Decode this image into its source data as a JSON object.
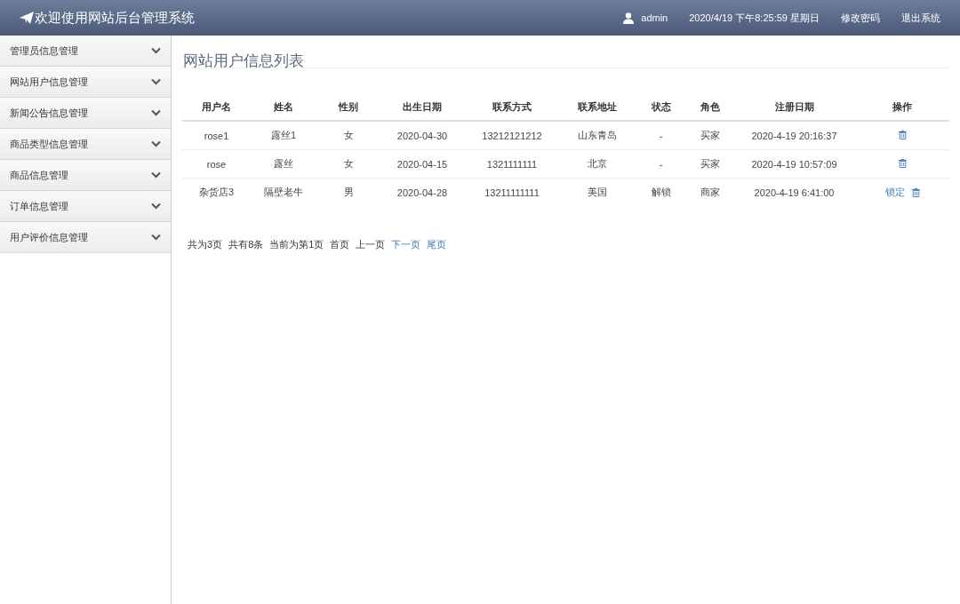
{
  "header": {
    "title": "欢迎使用网站后台管理系统",
    "user": "admin",
    "datetime": "2020/4/19 下午8:25:59 星期日",
    "links": [
      "修改密码",
      "退出系统"
    ]
  },
  "sidebar": {
    "items": [
      {
        "label": "管理员信息管理",
        "expanded": false
      },
      {
        "label": "网站用户信息管理",
        "expanded": false
      },
      {
        "label": "新闻公告信息管理",
        "expanded": false
      },
      {
        "label": "商品类型信息管理",
        "expanded": false
      },
      {
        "label": "商品信息管理",
        "expanded": false
      },
      {
        "label": "订单信息管理",
        "expanded": false
      },
      {
        "label": "用户评价信息管理",
        "expanded": false
      }
    ]
  },
  "page_title": "网站用户信息列表",
  "table": {
    "columns": [
      "用户名",
      "姓名",
      "性别",
      "出生日期",
      "联系方式",
      "联系地址",
      "状态",
      "角色",
      "注册日期",
      "操作"
    ],
    "rows": [
      {
        "cells": [
          "rose1",
          "露丝1",
          "女",
          "2020-04-30",
          "13212121212",
          "山东青岛",
          "-",
          "买家",
          "2020-4-19 20:16:37"
        ],
        "actions": [
          {
            "kind": "delete"
          }
        ]
      },
      {
        "cells": [
          "rose",
          "露丝",
          "女",
          "2020-04-15",
          "1321111111",
          "北京",
          "-",
          "买家",
          "2020-4-19 10:57:09"
        ],
        "actions": [
          {
            "kind": "delete"
          }
        ]
      },
      {
        "cells": [
          "杂货店3",
          "隔壁老牛",
          "男",
          "2020-04-28",
          "13211111111",
          "美国",
          "解锁",
          "商家",
          "2020-4-19 6:41:00"
        ],
        "actions": [
          {
            "kind": "link",
            "label": "锁定"
          },
          {
            "kind": "delete"
          }
        ]
      }
    ]
  },
  "pagination": [
    {
      "kind": "text",
      "label": "共为3页"
    },
    {
      "kind": "text",
      "label": "共有8条"
    },
    {
      "kind": "text",
      "label": "当前为第1页"
    },
    {
      "kind": "text",
      "label": "首页"
    },
    {
      "kind": "text",
      "label": "上一页"
    },
    {
      "kind": "link",
      "label": "下一页"
    },
    {
      "kind": "link",
      "label": "尾页"
    }
  ]
}
